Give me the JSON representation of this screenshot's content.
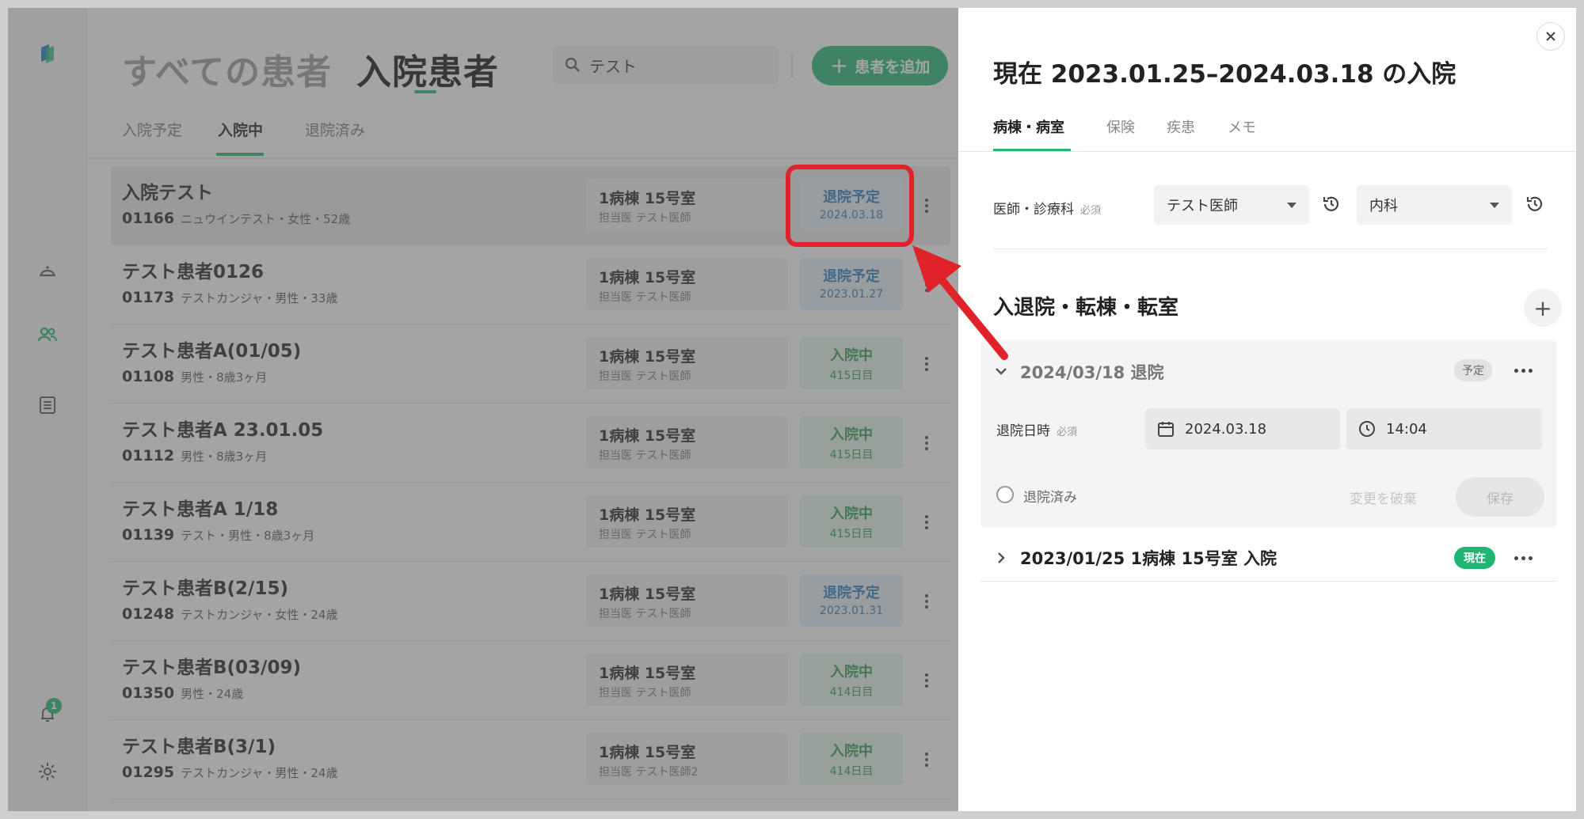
{
  "sidebar": {
    "items": [
      {
        "icon": "app-logo-icon"
      },
      {
        "icon": "bed-icon"
      },
      {
        "icon": "patients-icon"
      },
      {
        "icon": "list-icon"
      },
      {
        "icon": "bell-icon",
        "badge": "1"
      },
      {
        "icon": "gear-icon"
      }
    ]
  },
  "header": {
    "title_all": "すべての患者",
    "title_inpatient": "入院患者",
    "search_value": "テスト",
    "add_patient_label": "患者を追加"
  },
  "tabs": [
    "入院予定",
    "入院中",
    "退院済み"
  ],
  "patients": [
    {
      "name": "入院テスト",
      "id": "01166",
      "meta": "ニュウインテスト・女性・52歳",
      "room": "1病棟 15号室",
      "doctor": "担当医 テスト医師",
      "status": "退院予定",
      "status_sub": "2024.03.18",
      "status_type": "planned"
    },
    {
      "name": "テスト患者0126",
      "id": "01173",
      "meta": "テストカンジャ・男性・33歳",
      "room": "1病棟 15号室",
      "doctor": "担当医 テスト医師",
      "status": "退院予定",
      "status_sub": "2023.01.27",
      "status_type": "planned"
    },
    {
      "name": "テスト患者A(01/05)",
      "id": "01108",
      "meta": "男性・8歳3ヶ月",
      "room": "1病棟 15号室",
      "doctor": "担当医 テスト医師",
      "status": "入院中",
      "status_sub": "415日目",
      "status_type": "active"
    },
    {
      "name": "テスト患者A 23.01.05",
      "id": "01112",
      "meta": "男性・8歳3ヶ月",
      "room": "1病棟 15号室",
      "doctor": "担当医 テスト医師",
      "status": "入院中",
      "status_sub": "415日目",
      "status_type": "active"
    },
    {
      "name": "テスト患者A 1/18",
      "id": "01139",
      "meta": "テスト・男性・8歳3ヶ月",
      "room": "1病棟 15号室",
      "doctor": "担当医 テスト医師",
      "status": "入院中",
      "status_sub": "415日目",
      "status_type": "active"
    },
    {
      "name": "テスト患者B(2/15)",
      "id": "01248",
      "meta": "テストカンジャ・女性・24歳",
      "room": "1病棟 15号室",
      "doctor": "担当医 テスト医師",
      "status": "退院予定",
      "status_sub": "2023.01.31",
      "status_type": "planned"
    },
    {
      "name": "テスト患者B(03/09)",
      "id": "01350",
      "meta": "男性・24歳",
      "room": "1病棟 15号室",
      "doctor": "担当医 テスト医師",
      "status": "入院中",
      "status_sub": "414日目",
      "status_type": "active"
    },
    {
      "name": "テスト患者B(3/1)",
      "id": "01295",
      "meta": "テストカンジャ・男性・24歳",
      "room": "1病棟 15号室",
      "doctor": "担当医 テスト医師2",
      "status": "入院中",
      "status_sub": "414日目",
      "status_type": "active"
    }
  ],
  "panel": {
    "title": "現在 2023.01.25–2024.03.18 の入院",
    "tabs": [
      "病棟・病室",
      "保険",
      "疾患",
      "メモ"
    ],
    "doctor_label": "医師・診療科",
    "required": "必須",
    "doctor_value": "テスト医師",
    "department_value": "内科",
    "section_title": "入退院・転棟・転室",
    "event1": {
      "title": "2024/03/18 退院",
      "tag": "予定",
      "datetime_label": "退院日時",
      "date": "2024.03.18",
      "time": "14:04",
      "discharged_label": "退院済み",
      "discard_label": "変更を破棄",
      "save_label": "保存"
    },
    "event2": {
      "title": "2023/01/25 1病棟 15号室 入院",
      "tag": "現在"
    }
  },
  "colors": {
    "accent": "#1fb673",
    "highlight": "#e0232b",
    "planned_text": "#2a7ab8",
    "active_text": "#2e9b4f"
  }
}
